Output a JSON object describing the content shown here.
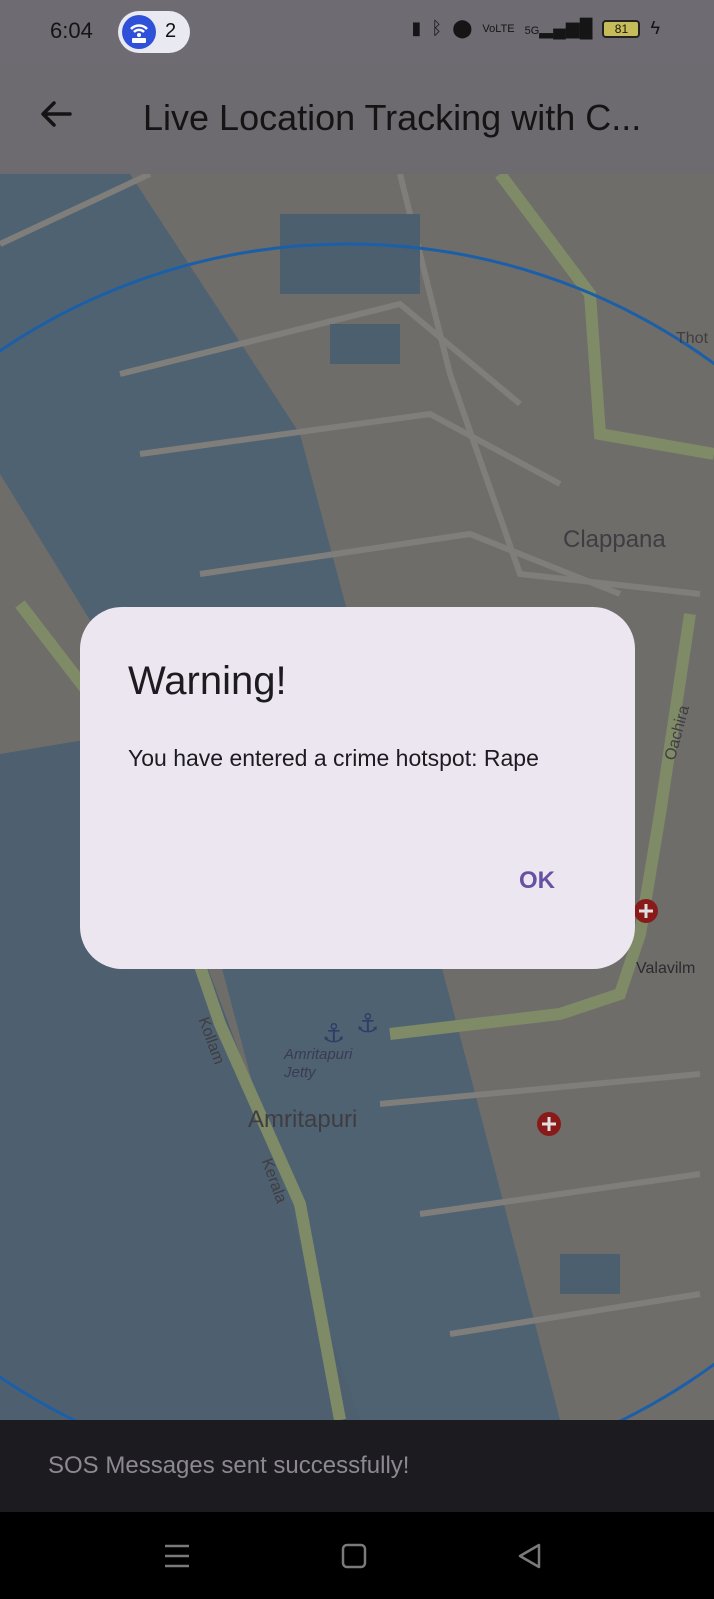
{
  "status_bar": {
    "time": "6:04",
    "hotspot_count": "2",
    "network": "5G",
    "battery": "81"
  },
  "app_bar": {
    "title": "Live Location Tracking with C..."
  },
  "map": {
    "labels": {
      "clappana": "Clappana",
      "amritapuri": "Amritapuri",
      "jetty": "Amritapuri Jetty",
      "valavil": "Valavilm",
      "thot": "Thot",
      "kollam": "Kollam",
      "kerala": "Kerala",
      "oachira": "Oachira"
    }
  },
  "dialog": {
    "title": "Warning!",
    "message": "You have entered a crime hotspot: Rape",
    "ok_label": "OK"
  },
  "snackbar": {
    "message": "SOS Messages sent successfully!"
  },
  "colors": {
    "scrim_map": "#6e6d6a",
    "dialog_bg": "#ece6f0",
    "primary": "#6750a4",
    "circle": "#1b5fa8"
  }
}
